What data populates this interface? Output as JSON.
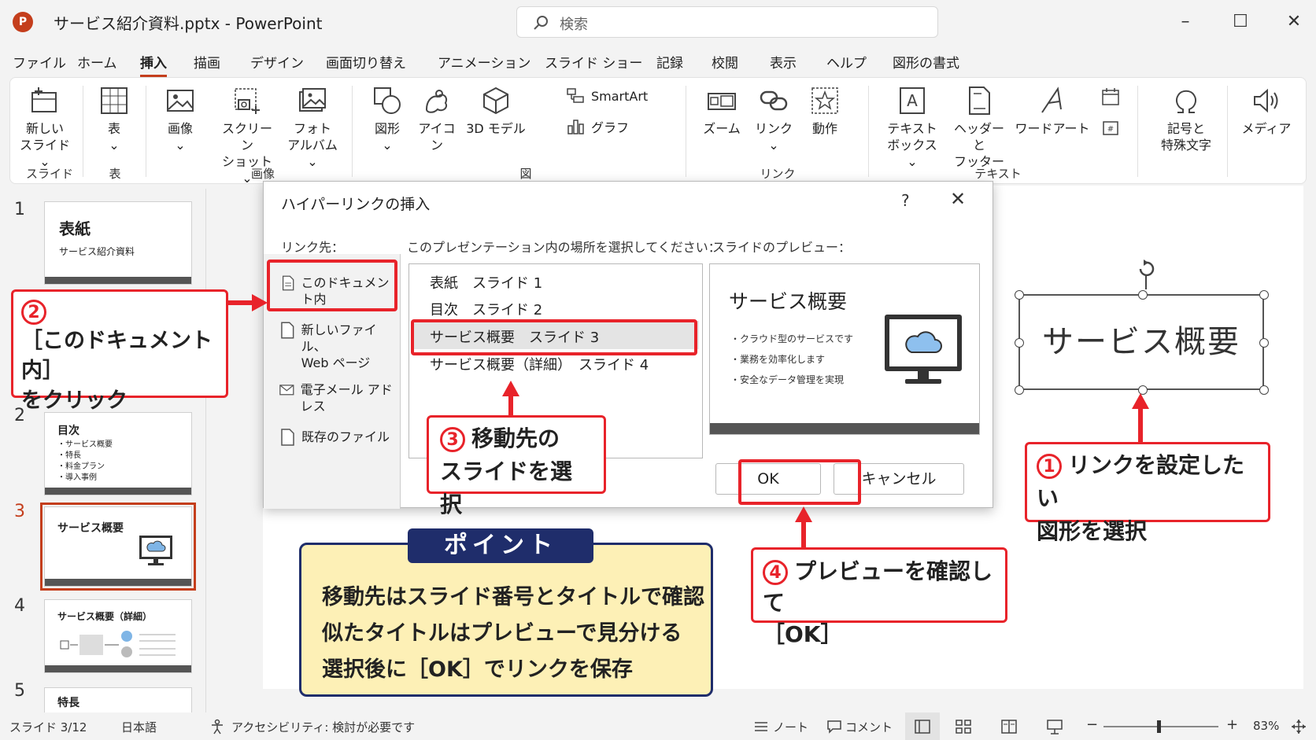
{
  "window": {
    "title": "サービス紹介資料.pptx - PowerPoint",
    "search_placeholder": "検索",
    "logo_letter": "P"
  },
  "menu": [
    "ファイル",
    "ホーム",
    "挿入",
    "描画",
    "デザイン",
    "画面切り替え",
    "アニメーション",
    "スライド ショー",
    "記録",
    "校閲",
    "表示",
    "ヘルプ",
    "図形の書式"
  ],
  "ribbon": {
    "new_slide": "新しい\nスライド ⌄",
    "table": "表\n⌄",
    "image": "画像\n⌄",
    "screenshot": "スクリーン\nショット ⌄",
    "photo_album": "フォト\nアルバム ⌄",
    "shapes": "図形\n⌄",
    "icons": "アイコン",
    "model3d": "3D モデル",
    "smartart": "SmartArt",
    "chart": "グラフ",
    "zoom": "ズーム",
    "link": "リンク\n⌄",
    "action": "動作",
    "textbox": "テキスト\nボックス ⌄",
    "header_footer": "ヘッダーと\nフッター",
    "wordart": "ワードアート",
    "symbols": "記号と\n特殊文字",
    "media": "メディア",
    "groups": {
      "slides": "スライド",
      "table": "表",
      "images": "画像",
      "illustrations": "図",
      "links": "リンク",
      "text": "テキスト"
    }
  },
  "slides_panel": [
    {
      "num": "1",
      "title": "表紙",
      "subtitle": "サービス紹介資料"
    },
    {
      "num": "2",
      "title": "目次",
      "bullets": [
        "・サービス概要",
        "・特長",
        "・料金プラン",
        "・導入事例"
      ]
    },
    {
      "num": "3",
      "title": "サービス概要"
    },
    {
      "num": "4",
      "title": "サービス概要（詳細）"
    },
    {
      "num": "5",
      "title": "特長"
    }
  ],
  "canvas": {
    "shape_text": "サービス概要"
  },
  "dialog": {
    "title": "ハイパーリンクの挿入",
    "help": "?",
    "close": "✕",
    "linkto_label": "リンク先：",
    "places_label": "このプレゼンテーション内の場所を選択してください：",
    "preview_label": "スライドのプレビュー：",
    "linkto_items": [
      "このドキュメント内",
      "新しいファイル、\nWeb ページ",
      "電子メール アドレス",
      "既存のファイル"
    ],
    "places": [
      "表紙　スライド 1",
      "目次　スライド 2",
      "サービス概要　スライド 3",
      "サービス概要（詳細）　スライド 4"
    ],
    "preview_title": "サービス概要",
    "preview_bullets": [
      "・クラウド型のサービスです",
      "・業務を効率化します",
      "・安全なデータ管理を実現"
    ],
    "ok": "OK",
    "cancel": "キャンセル"
  },
  "annotations": {
    "step1_num": "1",
    "step1_text": "リンクを設定したい\n図形を選択",
    "step2_num": "2",
    "step2_text": "［このドキュメント内］\nをクリック",
    "step3_num": "3",
    "step3_text": "移動先の\nスライドを選択",
    "step4_num": "4",
    "step4_text": "プレビューを確認して\n［OK］",
    "point_tag": "ポイント",
    "point_lines": [
      "移動先はスライド番号とタイトルで確認",
      "似たタイトルはプレビューで見分ける",
      "選択後に［OK］でリンクを保存"
    ],
    "accent_color": "#e8232a",
    "point_color": "#1f2d6b",
    "point_bg": "#fdf0b6"
  },
  "statusbar": {
    "slide": "スライド 3/12",
    "language": "日本語",
    "accessibility": "アクセシビリティ: 検討が必要です",
    "notes": "ノート",
    "comments": "コメント",
    "zoom": "83%",
    "minus": "−",
    "plus": "+"
  }
}
